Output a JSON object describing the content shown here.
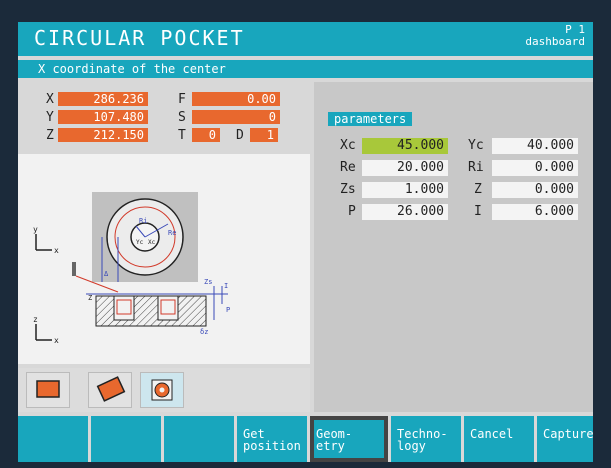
{
  "header": {
    "title": "CIRCULAR POCKET",
    "page": "P 1",
    "subtitle": "dashboard"
  },
  "hint": "X coordinate of the center",
  "readouts": {
    "x": {
      "label": "X",
      "value": "286.236"
    },
    "y": {
      "label": "Y",
      "value": "107.480"
    },
    "z": {
      "label": "Z",
      "value": "212.150"
    },
    "f": {
      "label": "F",
      "value": "0.00"
    },
    "s": {
      "label": "S",
      "value": "0"
    },
    "t": {
      "label": "T",
      "value": "0"
    },
    "d": {
      "label": "D",
      "value": "1"
    }
  },
  "drawing": {
    "axis_y_top": "y",
    "axis_x_top": "x",
    "axis_z_bottom": "z",
    "axis_x_bottom": "x",
    "label_ri": "Ri",
    "label_re": "Re",
    "label_yc": "Yc",
    "label_xc": "Xc",
    "label_zs": "Zs",
    "label_i": "I",
    "label_p": "P",
    "label_z": "Z",
    "label_dz": "δz",
    "label_delta": "Δ"
  },
  "parameters": {
    "label": "parameters",
    "rows": [
      {
        "l1": "Xc",
        "v1": "45.000",
        "l2": "Yc",
        "v2": "40.000"
      },
      {
        "l1": "Re",
        "v1": "20.000",
        "l2": "Ri",
        "v2": "0.000"
      },
      {
        "l1": "Zs",
        "v1": "1.000",
        "l2": "Z",
        "v2": "0.000"
      },
      {
        "l1": "P",
        "v1": "26.000",
        "l2": "I",
        "v2": "6.000"
      }
    ]
  },
  "softkeys": [
    "",
    "",
    "",
    "Get\nposition",
    "Geom-\netry",
    "Techno-\nlogy",
    "Cancel",
    "Capture"
  ],
  "colors": {
    "accent": "#18a6bd",
    "readout": "#e8682e",
    "active_field": "#a8c83a"
  }
}
